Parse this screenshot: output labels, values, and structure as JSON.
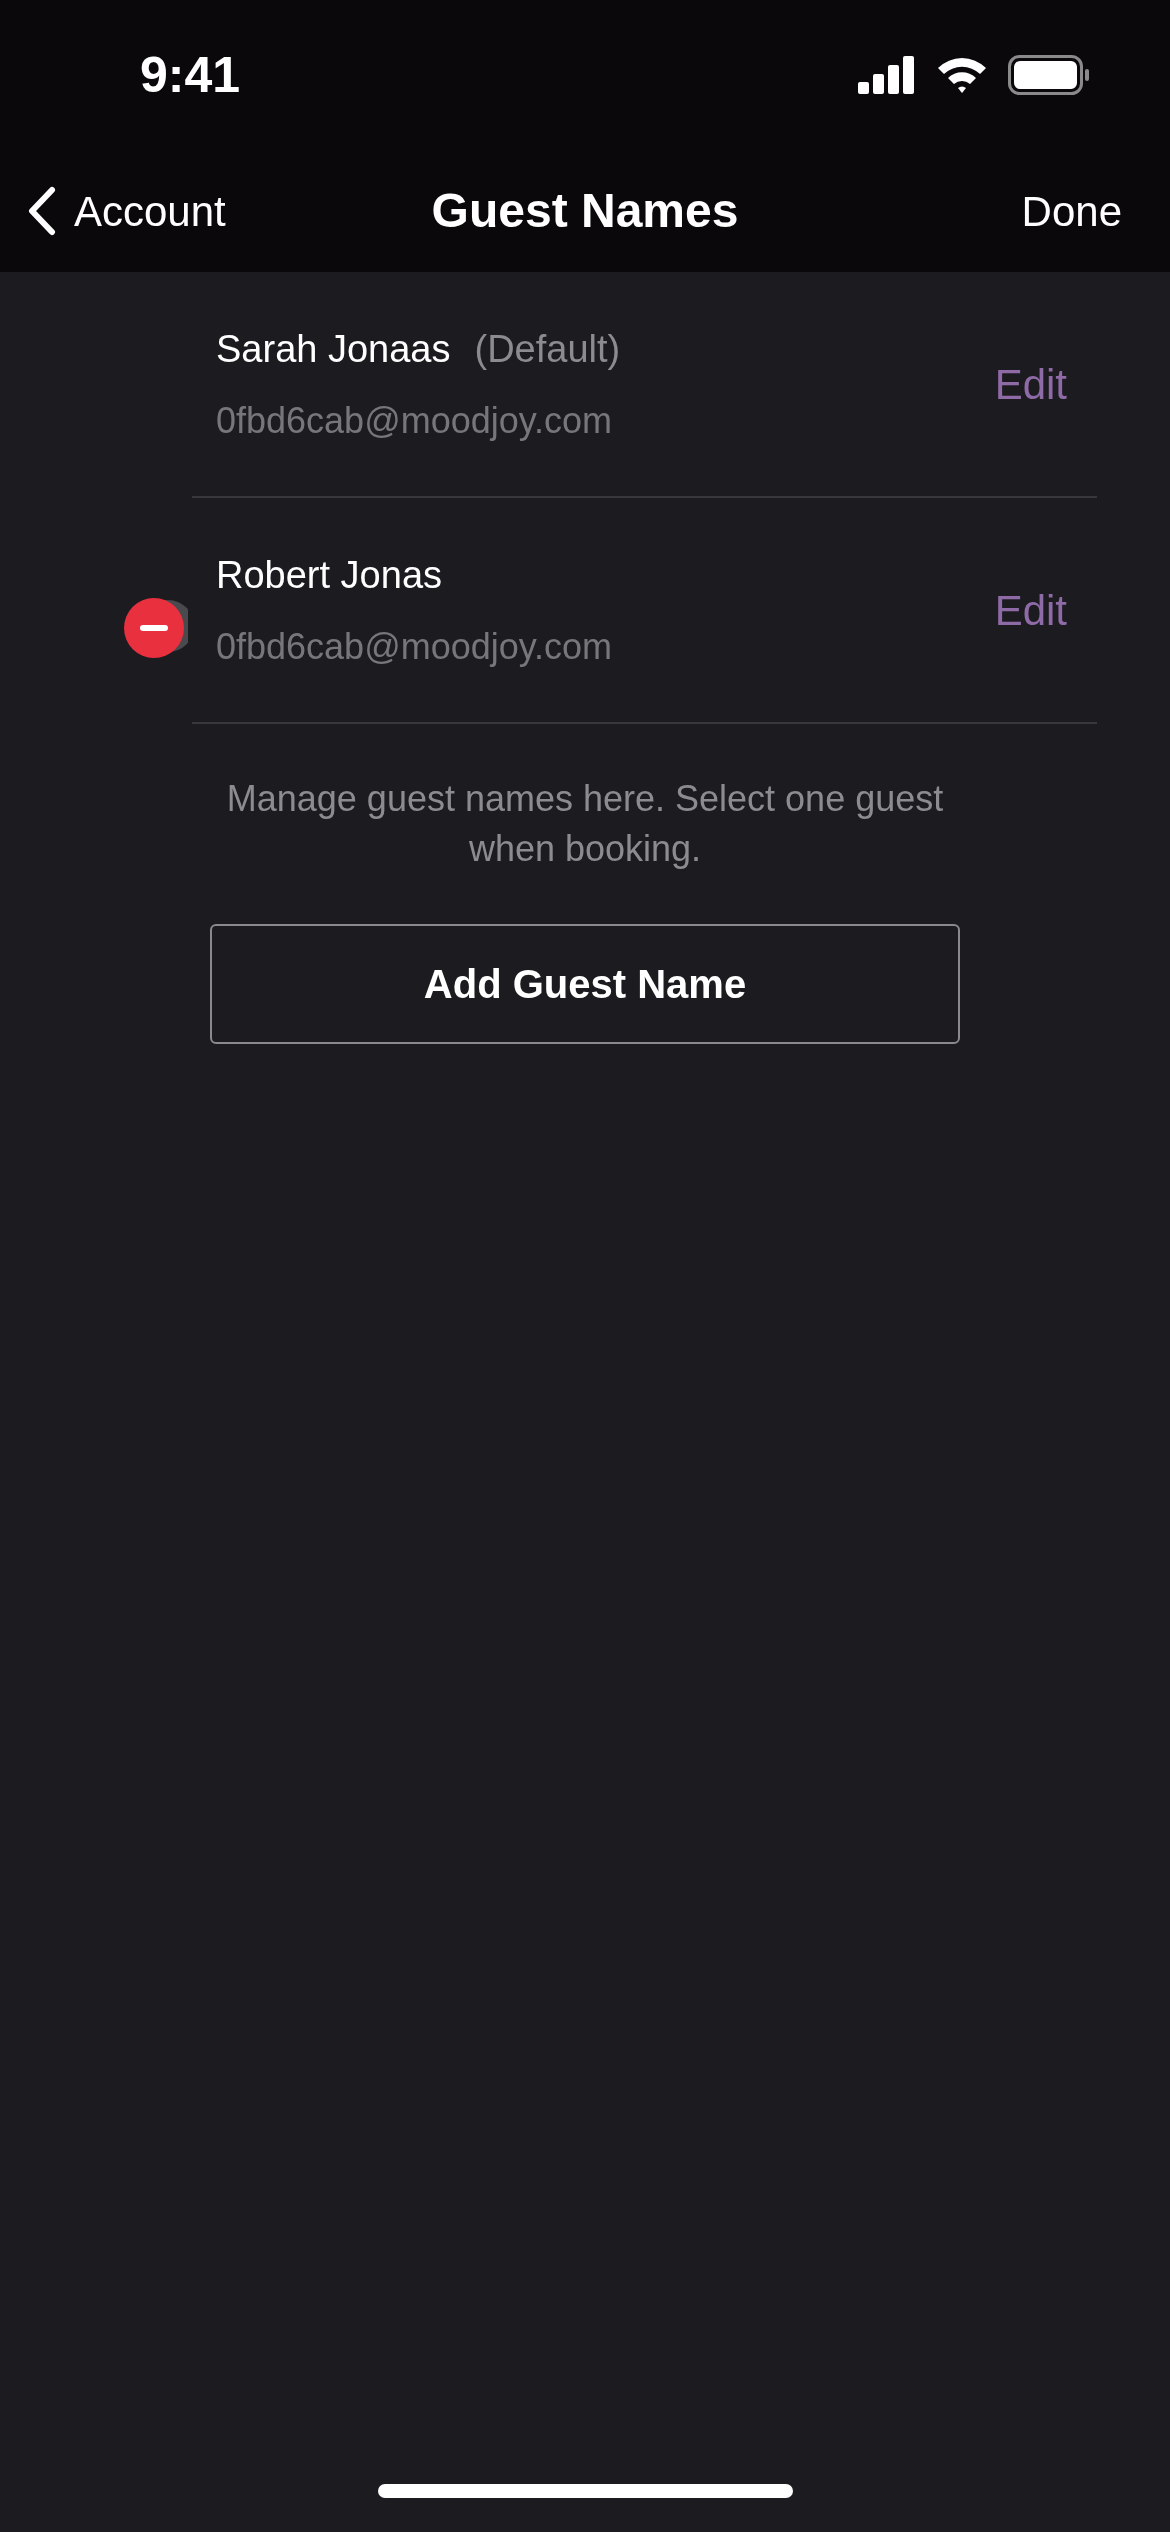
{
  "status_bar": {
    "time": "9:41"
  },
  "nav": {
    "back_label": "Account",
    "title": "Guest Names",
    "action": "Done"
  },
  "guests": [
    {
      "name": "Sarah Jonaas",
      "tag": "(Default)",
      "email": "0fbd6cab@moodjoy.com",
      "edit_label": "Edit",
      "delete_control": false
    },
    {
      "name": "Robert Jonas",
      "email": "0fbd6cab@moodjoy.com",
      "edit_label": "Edit",
      "delete_control": true
    }
  ],
  "footer_note": "Manage guest names here. Select one guest when booking.",
  "add_button": "Add Guest Name"
}
